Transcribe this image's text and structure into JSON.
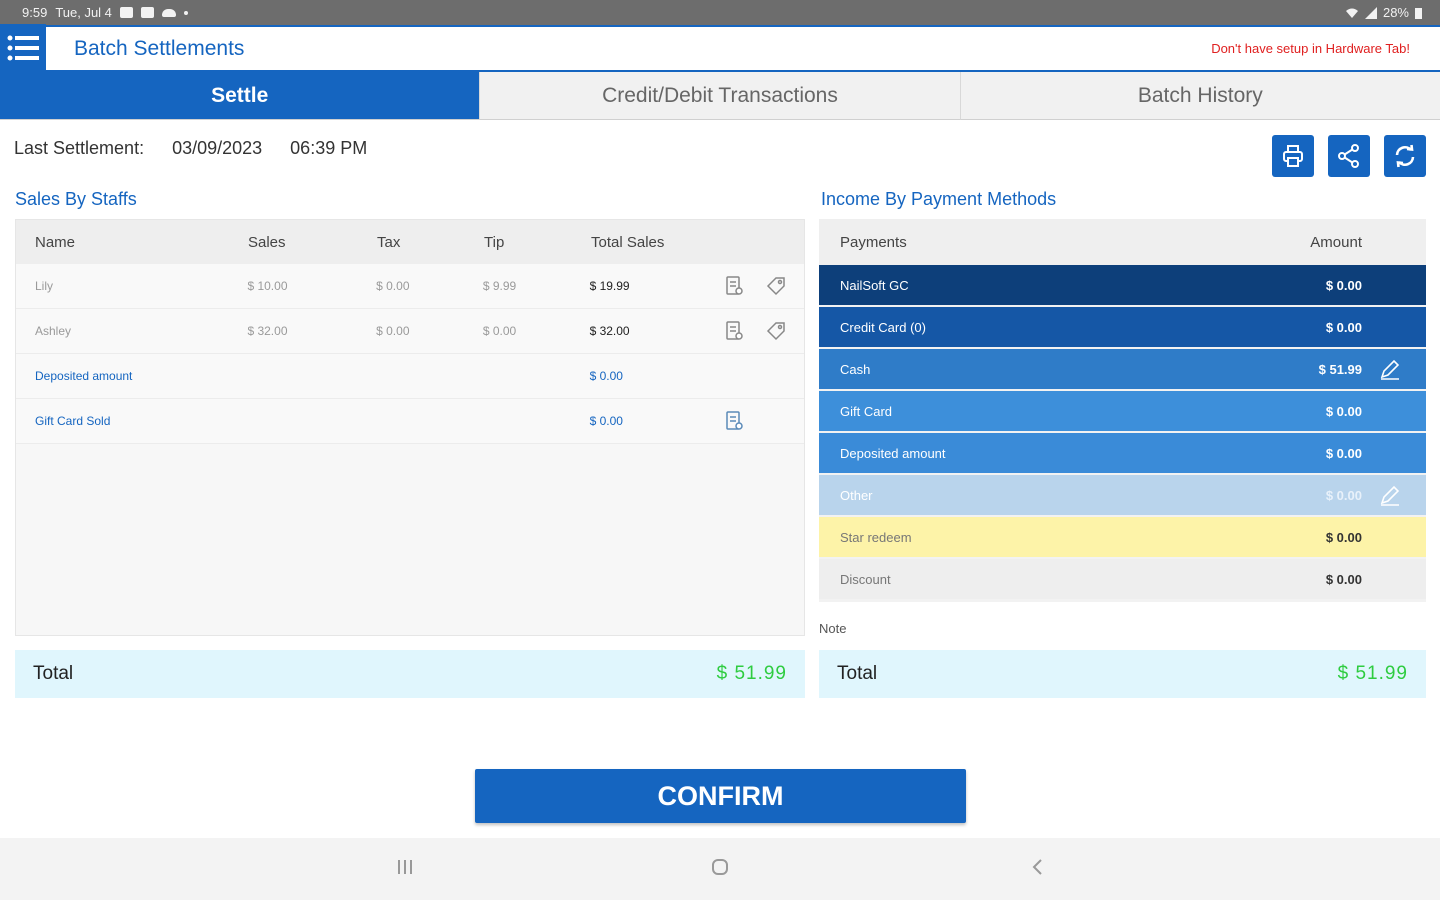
{
  "status": {
    "time": "9:59",
    "date": "Tue, Jul 4",
    "battery": "28%"
  },
  "app": {
    "title": "Batch Settlements",
    "hardware_warning": "Don't have setup in Hardware Tab!"
  },
  "tabs": [
    {
      "label": "Settle",
      "active": true
    },
    {
      "label": "Credit/Debit Transactions",
      "active": false
    },
    {
      "label": "Batch History",
      "active": false
    }
  ],
  "last_settlement": {
    "label": "Last Settlement:",
    "date": "03/09/2023",
    "time": "06:39 PM"
  },
  "actions": [
    {
      "name": "print",
      "icon": "printer-icon"
    },
    {
      "name": "share",
      "icon": "share-icon"
    },
    {
      "name": "refresh",
      "icon": "refresh-icon"
    }
  ],
  "staff": {
    "title": "Sales By Staffs",
    "headers": {
      "name": "Name",
      "sales": "Sales",
      "tax": "Tax",
      "tip": "Tip",
      "total": "Total Sales"
    },
    "rows": [
      {
        "name": "Lily",
        "sales": "$ 10.00",
        "tax": "$ 0.00",
        "tip": "$ 9.99",
        "total": "$ 19.99"
      },
      {
        "name": "Ashley",
        "sales": "$ 32.00",
        "tax": "$ 0.00",
        "tip": "$ 0.00",
        "total": "$ 32.00"
      }
    ],
    "extra_rows": [
      {
        "name": "Deposited amount",
        "total": "$ 0.00"
      },
      {
        "name": "Gift Card Sold",
        "total": "$ 0.00"
      }
    ],
    "total_label": "Total",
    "total_value": "$ 51.99"
  },
  "payments": {
    "title": "Income By Payment Methods",
    "headers": {
      "payments": "Payments",
      "amount": "Amount"
    },
    "rows": [
      {
        "label": "NailSoft GC",
        "amount": "$ 0.00"
      },
      {
        "label": "Credit Card (0)",
        "amount": "$ 0.00"
      },
      {
        "label": "Cash",
        "amount": "$ 51.99"
      },
      {
        "label": "Gift Card",
        "amount": "$ 0.00"
      },
      {
        "label": "Deposited amount",
        "amount": "$ 0.00"
      },
      {
        "label": "Other",
        "amount": "$ 0.00"
      },
      {
        "label": "Star redeem",
        "amount": "$ 0.00"
      },
      {
        "label": "Discount",
        "amount": "$ 0.00"
      }
    ],
    "colors": [
      "#0d3f7a",
      "#1557a6",
      "#2f7cc8",
      "#3d8fda",
      "#3a8bd8",
      "#b9d4ec",
      "#fdf3a8",
      "#eeeeee"
    ],
    "note_label": "Note",
    "total_label": "Total",
    "total_value": "$ 51.99"
  },
  "confirm_label": "CONFIRM",
  "theme": {
    "primary": "#1565c0",
    "total_green": "#2ecc40",
    "warning_red": "#e02020"
  }
}
